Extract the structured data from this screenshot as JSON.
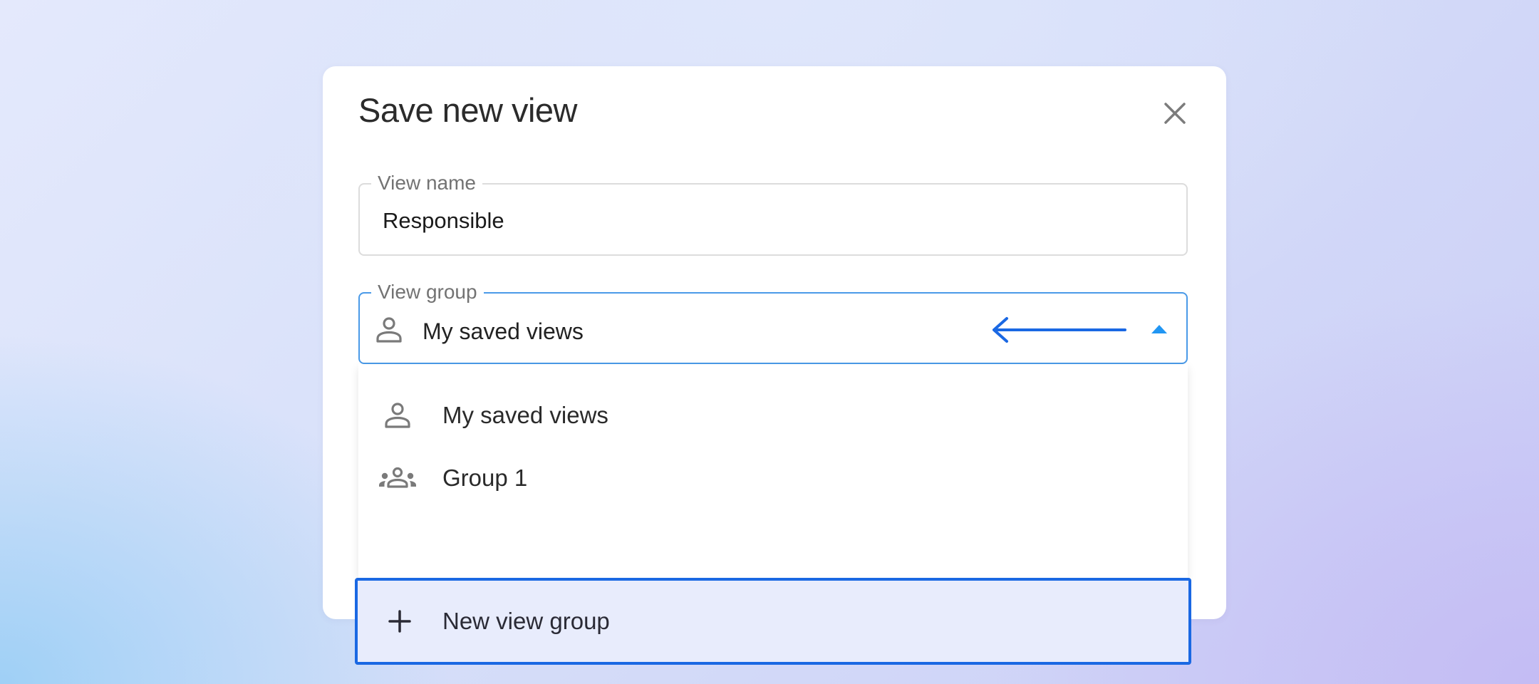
{
  "modal": {
    "title": "Save new view"
  },
  "view_name": {
    "label": "View name",
    "value": "Responsible"
  },
  "view_group": {
    "label": "View group",
    "selected": "My saved views",
    "selected_icon": "person-icon",
    "expanded": true
  },
  "dropdown": {
    "options": [
      {
        "label": "My saved views",
        "icon": "person-icon"
      },
      {
        "label": "Group 1",
        "icon": "group-icon"
      }
    ],
    "action": {
      "label": "New view group",
      "icon": "plus-icon"
    }
  },
  "colors": {
    "accent": "#1a68e3",
    "field_focus_border": "#4a9ae8",
    "caret": "#2196f3",
    "highlight_bg": "#e8ecfc",
    "icon_gray": "#7a7a7a"
  }
}
